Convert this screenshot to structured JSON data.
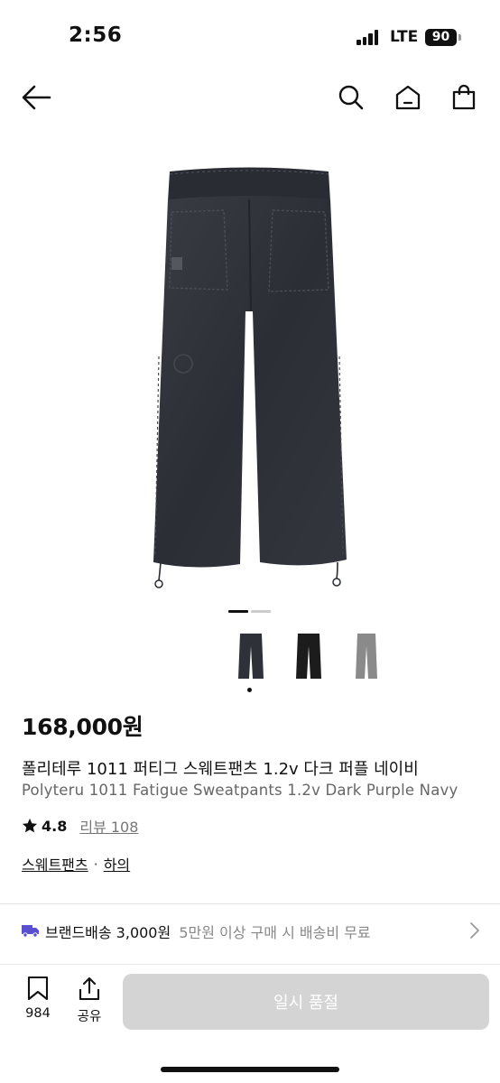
{
  "status_bar": {
    "time": "2:56",
    "carrier": "LTE",
    "battery": "90"
  },
  "nav": {
    "icons": [
      "back-arrow-icon",
      "search-icon",
      "home-icon",
      "shopping-bag-icon"
    ]
  },
  "product": {
    "price": "168,000원",
    "title_ko": "폴리테루 1011 퍼티그 스웨트팬츠 1.2v 다크 퍼플 네이비",
    "title_en": "Polyteru 1011 Fatigue Sweatpants 1.2v Dark Purple Navy",
    "rating": "4.8",
    "review_label": "리뷰 108",
    "category_1": "스웨트팬츠",
    "category_sep": "·",
    "category_2": "하의",
    "thumbnail_colors": [
      "#2f3138",
      "#1c1c1c",
      "#8a8a8a"
    ],
    "images_total": 2,
    "images_current": 1
  },
  "shipping": {
    "label": "브랜드배송 3,000원",
    "condition": "5만원 이상 구매 시 배송비 무료"
  },
  "bottom_bar": {
    "likes": "984",
    "share_label": "공유",
    "soldout_label": "일시 품절"
  },
  "colors": {
    "accent_ship": "#5a4fcf",
    "disabled_button": "#d4d4d4"
  }
}
